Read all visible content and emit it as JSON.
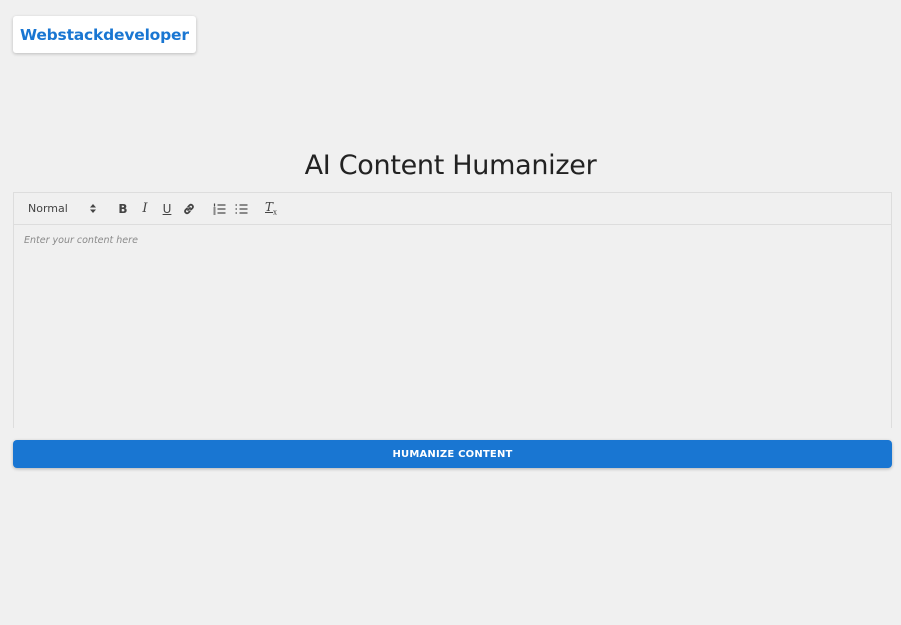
{
  "header": {
    "brand": "Webstackdeveloper"
  },
  "page": {
    "title": "AI Content Humanizer"
  },
  "editor": {
    "toolbar": {
      "format_select": "Normal",
      "buttons": [
        {
          "name": "bold",
          "glyph": "B"
        },
        {
          "name": "italic",
          "glyph": "I"
        },
        {
          "name": "underline",
          "glyph": "U"
        },
        {
          "name": "link",
          "icon": "link-icon"
        },
        {
          "name": "ordered-list",
          "icon": "ordered-list-icon"
        },
        {
          "name": "bullet-list",
          "icon": "bullet-list-icon"
        },
        {
          "name": "clean",
          "glyph": "T",
          "sub": "x"
        }
      ]
    },
    "placeholder": "Enter your content here",
    "value": ""
  },
  "actions": {
    "humanize_label": "HUMANIZE CONTENT",
    "accent_color": "#1976d2"
  }
}
